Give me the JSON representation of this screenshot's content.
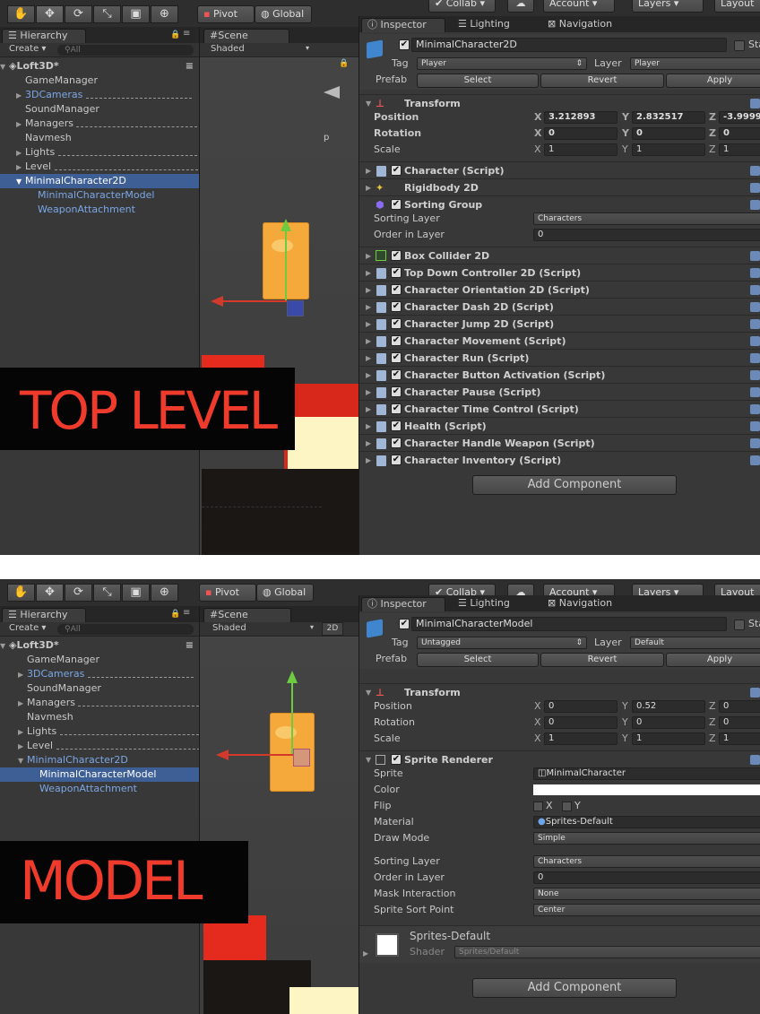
{
  "toolbar": {
    "tools": [
      "hand-icon",
      "move-icon",
      "rotate-icon",
      "scale-icon",
      "rect-icon",
      "transform-icon"
    ],
    "pivot": "Pivot",
    "global": "Global",
    "collab": "Collab",
    "account": "Account",
    "layers": "Layers",
    "layout": "Layout"
  },
  "top": {
    "hierarchy_tab": "Hierarchy",
    "create": "Create",
    "search_placeholder": "All",
    "scene_tab": "Scene",
    "shading": "Shaded",
    "scene_name": "Loft3D*",
    "rows": [
      {
        "label": "GameManager"
      },
      {
        "label": "3DCameras"
      },
      {
        "label": "SoundManager"
      },
      {
        "label": "Managers"
      },
      {
        "label": "Navmesh"
      },
      {
        "label": "Lights"
      },
      {
        "label": "Level"
      },
      {
        "label": "MinimalCharacter2D"
      },
      {
        "label": "MinimalCharacterModel"
      },
      {
        "label": "WeaponAttachment"
      }
    ],
    "overlay_text": "TOP LEVEL",
    "inspector": {
      "tabs": [
        "Inspector",
        "Lighting",
        "Navigation"
      ],
      "object_name": "MinimalCharacter2D",
      "static_label": "Sta",
      "tag_label": "Tag",
      "tag_value": "Player",
      "layer_label": "Layer",
      "layer_value": "Player",
      "prefab_label": "Prefab",
      "prefab_buttons": [
        "Select",
        "Revert",
        "Apply"
      ],
      "transform": {
        "title": "Transform",
        "rows": [
          {
            "label": "Position",
            "x": "3.212893",
            "y": "2.832517",
            "z": "-3.9999"
          },
          {
            "label": "Rotation",
            "x": "0",
            "y": "0",
            "z": "0"
          },
          {
            "label": "Scale",
            "x": "1",
            "y": "1",
            "z": "1"
          }
        ]
      },
      "comp_before": [
        "Character (Script)",
        "Rigidbody 2D",
        "Sorting Group"
      ],
      "sorting_layer_label": "Sorting Layer",
      "sorting_layer_value": "Characters",
      "order_label": "Order in Layer",
      "order_value": "0",
      "components": [
        "Box Collider 2D",
        "Top Down Controller 2D (Script)",
        "Character Orientation 2D (Script)",
        "Character Dash 2D (Script)",
        "Character Jump 2D (Script)",
        "Character Movement (Script)",
        "Character Run (Script)",
        "Character Button Activation (Script)",
        "Character Pause (Script)",
        "Character Time Control (Script)",
        "Health (Script)",
        "Character Handle Weapon (Script)",
        "Character Inventory (Script)"
      ],
      "add_component": "Add Component"
    }
  },
  "bottom": {
    "hierarchy_tab": "Hierarchy",
    "create": "Create",
    "search_placeholder": "All",
    "scene_tab": "Scene",
    "shading": "Shaded",
    "mode_2d": "2D",
    "scene_name": "Loft3D*",
    "rows": [
      {
        "label": "GameManager"
      },
      {
        "label": "3DCameras"
      },
      {
        "label": "SoundManager"
      },
      {
        "label": "Managers"
      },
      {
        "label": "Navmesh"
      },
      {
        "label": "Lights"
      },
      {
        "label": "Level"
      },
      {
        "label": "MinimalCharacter2D"
      },
      {
        "label": "MinimalCharacterModel"
      },
      {
        "label": "WeaponAttachment"
      }
    ],
    "overlay_text": "MODEL",
    "inspector": {
      "tabs": [
        "Inspector",
        "Lighting",
        "Navigation"
      ],
      "object_name": "MinimalCharacterModel",
      "static_label": "Sta",
      "tag_label": "Tag",
      "tag_value": "Untagged",
      "layer_label": "Layer",
      "layer_value": "Default",
      "prefab_label": "Prefab",
      "prefab_buttons": [
        "Select",
        "Revert",
        "Apply"
      ],
      "transform": {
        "title": "Transform",
        "rows": [
          {
            "label": "Position",
            "x": "0",
            "y": "0.52",
            "z": "0"
          },
          {
            "label": "Rotation",
            "x": "0",
            "y": "0",
            "z": "0"
          },
          {
            "label": "Scale",
            "x": "1",
            "y": "1",
            "z": "1"
          }
        ]
      },
      "sprite_renderer": {
        "title": "Sprite Renderer",
        "sprite_label": "Sprite",
        "sprite_value": "MinimalCharacter",
        "color_label": "Color",
        "flip_label": "Flip",
        "flip_x": "X",
        "flip_y": "Y",
        "material_label": "Material",
        "material_value": "Sprites-Default",
        "draw_mode_label": "Draw Mode",
        "draw_mode_value": "Simple",
        "sorting_layer_label": "Sorting Layer",
        "sorting_layer_value": "Characters",
        "order_label": "Order in Layer",
        "order_value": "0",
        "mask_label": "Mask Interaction",
        "mask_value": "None",
        "sort_point_label": "Sprite Sort Point",
        "sort_point_value": "Center"
      },
      "material_block": {
        "name": "Sprites-Default",
        "shader_label": "Shader",
        "shader_value": "Sprites/Default"
      },
      "add_component": "Add Component"
    }
  },
  "colors": {
    "selection": "#3e5f96",
    "overlay_text": "#ee3b2c",
    "sprite": "#f6a93b",
    "blue_text": "#7ba7e6"
  }
}
